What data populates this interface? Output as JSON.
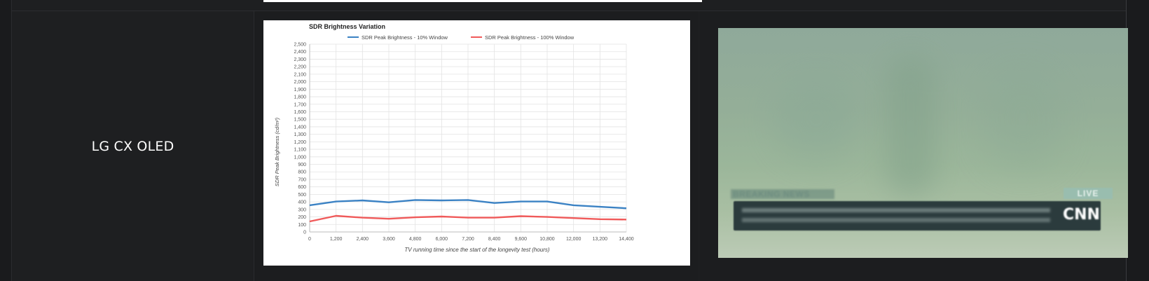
{
  "row": {
    "tv_name": "LG CX OLED"
  },
  "photo": {
    "breaking_text": "BREAKING NEWS",
    "live_text": "LIVE",
    "network": "CNN"
  },
  "chart_data": {
    "type": "line",
    "title": "SDR Brightness Variation",
    "xlabel": "TV running time since the start of the longevity test (hours)",
    "ylabel": "SDR Peak Brightness (cd/m²)",
    "xlim": [
      0,
      14400
    ],
    "ylim": [
      0,
      2500
    ],
    "x_ticks": [
      0,
      1200,
      2400,
      3600,
      4800,
      6000,
      7200,
      8400,
      9600,
      10800,
      12000,
      13200,
      14400
    ],
    "y_ticks": [
      0,
      100,
      200,
      300,
      400,
      500,
      600,
      700,
      800,
      900,
      1000,
      1100,
      1200,
      1300,
      1400,
      1500,
      1600,
      1700,
      1800,
      1900,
      2000,
      2100,
      2200,
      2300,
      2400,
      2500
    ],
    "grid": true,
    "legend": "top",
    "colors": {
      "blue": "#3b82c4",
      "red": "#f05a5a"
    },
    "series": [
      {
        "name": "SDR Peak Brightness - 10% Window",
        "color": "#3b82c4",
        "x": [
          0,
          1200,
          2400,
          3600,
          4800,
          6000,
          7200,
          8400,
          9600,
          10800,
          12000,
          13200,
          14400
        ],
        "values": [
          355,
          405,
          420,
          395,
          425,
          420,
          425,
          385,
          405,
          405,
          355,
          335,
          315
        ]
      },
      {
        "name": "SDR Peak Brightness - 100% Window",
        "color": "#f05a5a",
        "x": [
          0,
          1200,
          2400,
          3600,
          4800,
          6000,
          7200,
          8400,
          9600,
          10800,
          12000,
          13200,
          14400
        ],
        "values": [
          140,
          215,
          190,
          175,
          195,
          205,
          190,
          190,
          210,
          200,
          185,
          170,
          165
        ]
      }
    ]
  }
}
